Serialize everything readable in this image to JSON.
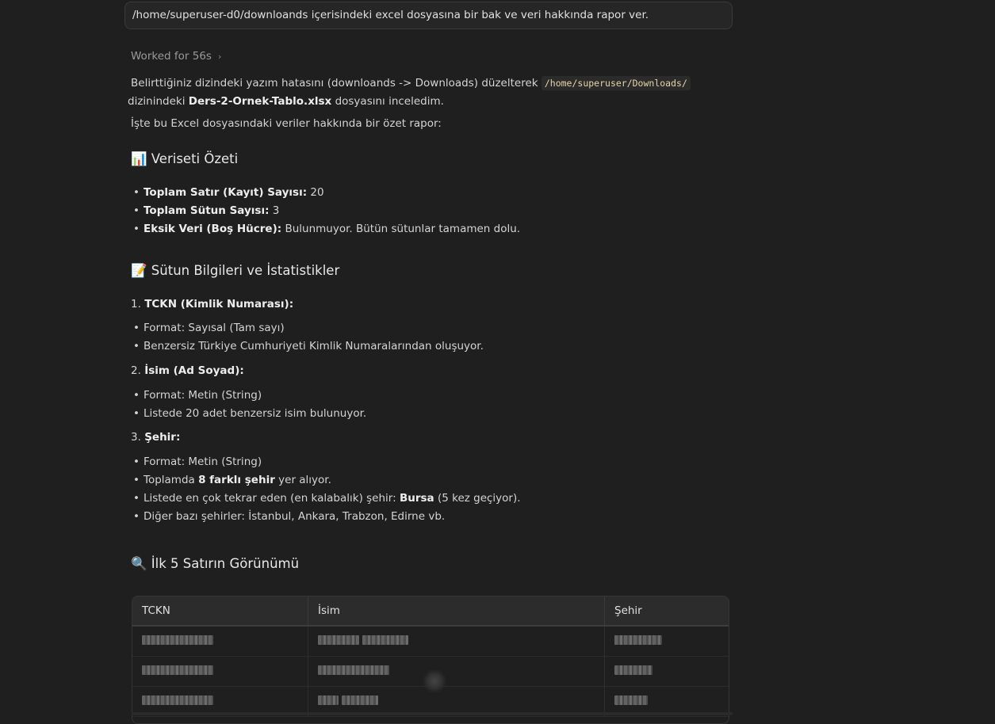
{
  "prompt": "/home/superuser-d0/downloands içerisindeki excel dosyasına bir bak ve veri hakkında rapor ver.",
  "worked_label": "Worked for 56s",
  "intro": {
    "part1": "Belirttiğiniz dizindeki yazım hatasını (downloands -> Downloads) düzelterek ",
    "path": "/home/superuser/Downloads/",
    "part2": " dizinindeki ",
    "filename": "Ders-2-Ornek-Tablo.xlsx",
    "part3": " dosyasını inceledim."
  },
  "summary_intro": "İşte bu Excel dosyasındaki veriler hakkında bir özet rapor:",
  "section_overview": {
    "emoji": "📊",
    "title": "Veriseti Özeti"
  },
  "overview": [
    {
      "label": "Toplam Satır (Kayıt) Sayısı:",
      "value": " 20"
    },
    {
      "label": "Toplam Sütun Sayısı:",
      "value": " 3"
    },
    {
      "label": "Eksik Veri (Boş Hücre):",
      "value": " Bulunmuyor. Bütün sütunlar tamamen dolu."
    }
  ],
  "section_columns": {
    "emoji": "📝",
    "title": "Sütun Bilgileri ve İstatistikler"
  },
  "columns": [
    {
      "num": "1.",
      "title": "TCKN (Kimlik Numarası):",
      "items": [
        "Format: Sayısal (Tam sayı)",
        "Benzersiz Türkiye Cumhuriyeti Kimlik Numaralarından oluşuyor."
      ]
    },
    {
      "num": "2.",
      "title": "İsim (Ad Soyad):",
      "items": [
        "Format: Metin (String)",
        "Listede 20 adet benzersiz isim bulunuyor."
      ]
    },
    {
      "num": "3.",
      "title": "Şehir:",
      "items": {
        "format": "Format: Metin (String)",
        "count_pre": "Toplamda ",
        "count_bold": "8 farklı şehir",
        "count_post": " yer alıyor.",
        "top_pre": "Listede en çok tekrar eden (en kalabalık) şehir: ",
        "top_bold": "Bursa",
        "top_post": " (5 kez geçiyor).",
        "others": "Diğer bazı şehirler: İstanbul, Ankara, Trabzon, Edirne vb."
      }
    }
  ],
  "section_preview": {
    "emoji": "🔍",
    "title": "İlk 5 Satırın Görünümü"
  },
  "table": {
    "headers": [
      "TCKN",
      "İsim",
      "Şehir"
    ]
  }
}
